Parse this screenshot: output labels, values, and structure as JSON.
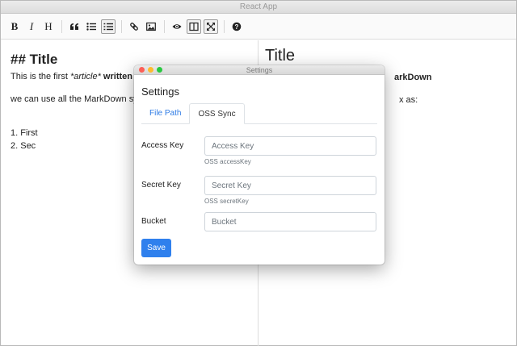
{
  "window": {
    "title": "React App"
  },
  "toolbar": {
    "bold": "B",
    "italic": "I",
    "heading": "H",
    "quote": "❝",
    "unordered_list": "☰",
    "ordered_list": "≣",
    "link": "🔗",
    "image": "▣",
    "preview": "👁",
    "side_by_side": "◫",
    "fullscreen": "⤢",
    "help": "?"
  },
  "editor": {
    "heading": "## Title",
    "line1_prefix": "This is the first ",
    "line1_italic": "*article*",
    "line1_suffix": " written by **",
    "line2": "we can use all the MarkDown syntax",
    "list": [
      "1.  First",
      "2.  Sec"
    ]
  },
  "preview": {
    "heading": "Title",
    "line1": "arkDown",
    "line2": "x as:"
  },
  "dialog": {
    "window_title": "Settings",
    "title": "Settings",
    "tabs": [
      "File Path",
      "OSS Sync"
    ],
    "fields": {
      "access_key": {
        "label": "Access Key",
        "placeholder": "Access Key",
        "help": "OSS accessKey"
      },
      "secret_key": {
        "label": "Secret Key",
        "placeholder": "Secret Key",
        "help": "OSS secretKey"
      },
      "bucket": {
        "label": "Bucket",
        "placeholder": "Bucket"
      }
    },
    "save_label": "Save"
  }
}
